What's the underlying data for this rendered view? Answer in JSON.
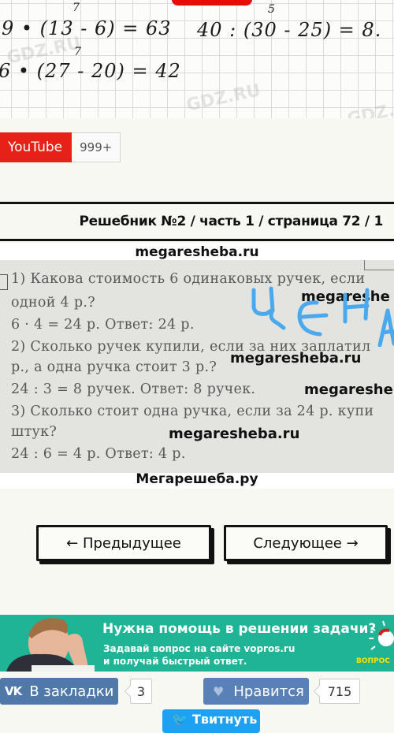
{
  "notebook": {
    "lines": [
      {
        "sup": "7",
        "text": "9 • (13 - 6) = 63"
      },
      {
        "sup": "5",
        "text": "40 : (30 - 25) = 8."
      },
      {
        "sup": "7",
        "text": "6 • (27 - 20) = 42"
      }
    ],
    "watermark": "GDZ.RU"
  },
  "youtube": {
    "label": "YouTube",
    "count": "999+"
  },
  "heading": {
    "text": "Решебник №2 / часть 1 / страница 72 / 1"
  },
  "scan": {
    "site_top": "megaresheba.ru",
    "lines": [
      "1) Какова стоимость 6 одинаковых ручек, если",
      "одной 4 р.?",
      "6 · 4 = 24 р. Ответ: 24 р.",
      "2) Сколько ручек купили, если за них заплатил",
      "р., а одна ручка стоит 3 р.?",
      "24 : 3 = 8 ручек. Ответ: 8 ручек.",
      "3) Сколько стоит одна ручка, если за 24 р. купи",
      "штук?",
      "24 : 6 = 4 р. Ответ: 4 р."
    ],
    "watermarks": [
      "megareshe",
      "megaresheba.ru",
      "megareshe",
      "megaresheba.ru"
    ],
    "handwriting": "ЦЕНА",
    "site_bottom": "Мегарешеба.ру"
  },
  "navigation": {
    "prev_label": "← Предыдущее",
    "next_label": "Следующее →"
  },
  "ad": {
    "title": "Нужна помощь в решении задачи?",
    "line1": "Задавай вопрос на сайте vopros.ru",
    "line2": "и получай быстрый ответ.",
    "logo_text": "ВОПРОС"
  },
  "social": {
    "vk_label": "В закладки",
    "vk_count": "3",
    "like_label": "Нравится",
    "like_count": "715",
    "twitter_label": "Твитнуть"
  },
  "colors": {
    "youtube_red": "#e62117",
    "ad_green": "#1fb496",
    "vk_blue": "#5078a8",
    "twitter_blue": "#1da1f2",
    "ink_blue": "#4aa8ec"
  }
}
